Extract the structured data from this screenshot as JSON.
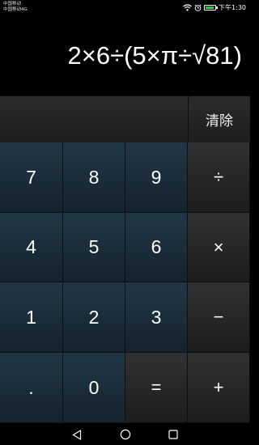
{
  "status_bar": {
    "carrier_1": "中国移动",
    "carrier_2": "中国移动4G",
    "time": "下午1:30",
    "icons": [
      "wifi-icon",
      "alarm-icon",
      "battery-icon"
    ]
  },
  "display": {
    "expression": "2×6÷(5×π÷√81)"
  },
  "clear_button": {
    "label": "清除"
  },
  "keypad": {
    "rows": [
      [
        "7",
        "8",
        "9",
        "÷"
      ],
      [
        "4",
        "5",
        "6",
        "×"
      ],
      [
        "1",
        "2",
        "3",
        "−"
      ],
      [
        ".",
        "0",
        "=",
        "+"
      ]
    ]
  },
  "nav_bar": {
    "icons": [
      "back-icon",
      "home-icon",
      "recents-icon"
    ]
  },
  "colors": {
    "digit_key": "#1b2d3a",
    "operator_key": "#262626",
    "background": "#000000",
    "battery": "#2ecc40"
  }
}
